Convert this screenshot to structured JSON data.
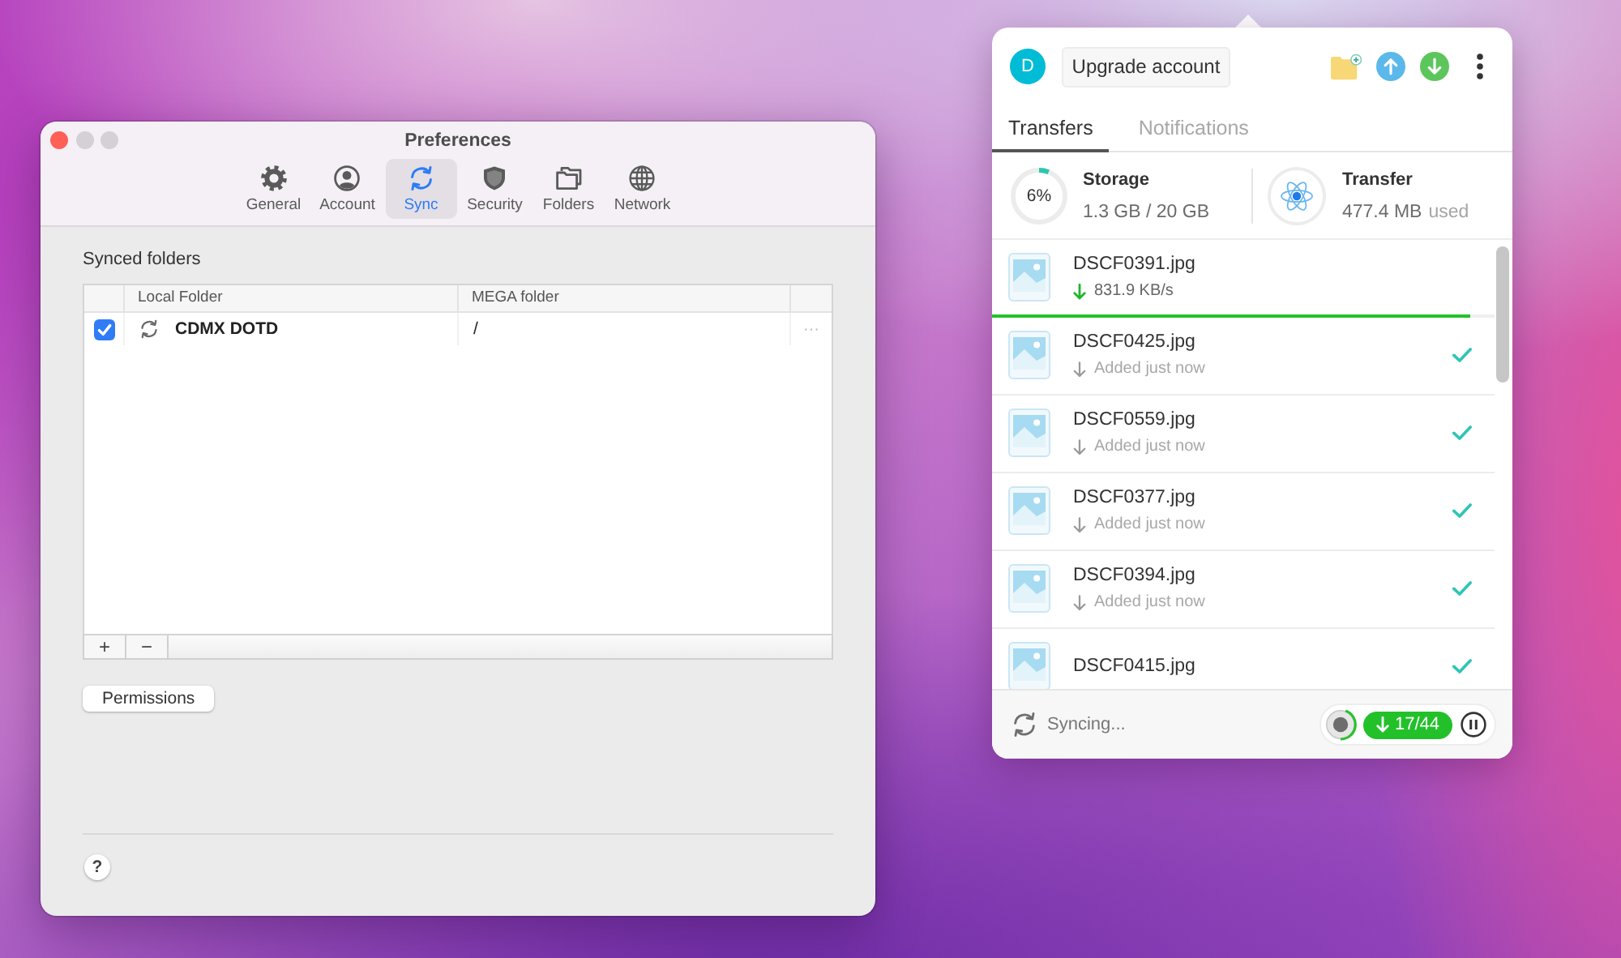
{
  "preferences": {
    "window": {
      "title": "Preferences",
      "buttons": [
        {
          "kind": "close",
          "disabled": false
        },
        {
          "kind": "minimize",
          "disabled": true
        },
        {
          "kind": "zoom",
          "disabled": true
        }
      ]
    },
    "toolbar": [
      {
        "kind": "general",
        "label": "General",
        "selected": false
      },
      {
        "kind": "account",
        "label": "Account",
        "selected": false
      },
      {
        "kind": "sync",
        "label": "Sync",
        "selected": true
      },
      {
        "kind": "security",
        "label": "Security",
        "selected": false
      },
      {
        "kind": "folders",
        "label": "Folders",
        "selected": false
      },
      {
        "kind": "network",
        "label": "Network",
        "selected": false
      }
    ],
    "section_title": "Synced folders",
    "table": {
      "columns": [
        "Local Folder",
        "MEGA folder"
      ],
      "rows": [
        {
          "checked": true,
          "local_folder": "CDMX DOTD",
          "mega_folder": "/",
          "more": "···"
        }
      ]
    },
    "list_buttons": [
      "+",
      "−"
    ],
    "permissions_button": "Permissions",
    "help_button": "?"
  },
  "transfer_manager": {
    "avatar": "D",
    "upgrade_button": "Upgrade account",
    "tabs": [
      {
        "label": "Transfers",
        "selected": true
      },
      {
        "label": "Notifications",
        "selected": false
      }
    ],
    "storage": {
      "title": "Storage",
      "percent": "6%",
      "level": 0.06,
      "usage": "1.3 GB / 20 GB"
    },
    "transfer": {
      "title": "Transfer",
      "amount": "477.4 MB",
      "note": "used"
    },
    "transfers": [
      {
        "kind": "active",
        "name": "DSCF0391.jpg",
        "status": "831.9 KB/s",
        "level": 0.95
      },
      {
        "kind": "done",
        "name": "DSCF0425.jpg",
        "status": "Added just now"
      },
      {
        "kind": "done",
        "name": "DSCF0559.jpg",
        "status": "Added just now"
      },
      {
        "kind": "done",
        "name": "DSCF0377.jpg",
        "status": "Added just now"
      },
      {
        "kind": "done",
        "name": "DSCF0394.jpg",
        "status": "Added just now"
      },
      {
        "kind": "done",
        "name": "DSCF0415.jpg"
      }
    ],
    "footer": {
      "status": "Syncing...",
      "count": "17/44"
    }
  }
}
